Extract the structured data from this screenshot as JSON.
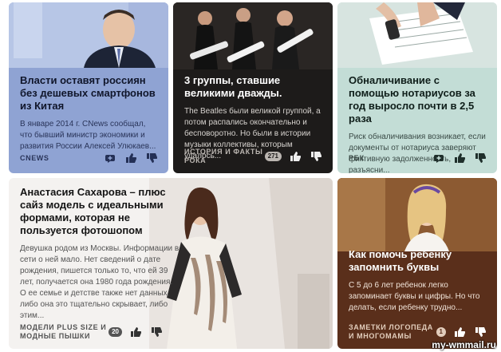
{
  "cards": [
    {
      "title": "Власти оставят россиян без дешевых смартфонов из Китая",
      "snippet": "В январе 2014 г. CNews сообщал, что бывший министр экономики и развития России Алексей Улюкаев...",
      "source": "CNEWS",
      "count": "",
      "colors": {
        "background": "#8fa3d3"
      }
    },
    {
      "title": "3 группы, ставшие великими дважды.",
      "snippet": "The Beatles были великой группой, а потом распались окончательно и бесповоротно. Но были в истории музыки коллективы, которым удалось...",
      "source_line1": "ИСТОРИЯ И ФАКТЫ",
      "source_line2": "РОКА",
      "count": "271",
      "colors": {
        "background": "#1d1b1a"
      }
    },
    {
      "title": "Обналичивание с помощью нотариусов за год выросло почти в 2,5 раза",
      "snippet": "Риск обналичивания возникает, если документы от нотариуса заверяют фиктивную задолженность, разъясни...",
      "source": "РБК",
      "count": "",
      "colors": {
        "background": "#c3ddd6"
      }
    },
    {
      "title": "Анастасия Сахарова – плюс сайз модель с идеальными формами, которая не пользуется фотошопом",
      "snippet": "Девушка родом из Москвы. Информации в сети о ней мало. Нет сведений о дате рождения, пишется только то, что ей 39 лет, получается она 1980 года рождения. О ее семье и детстве также нет данных, либо она это тщательно скрывает, либо этим...",
      "source_line1": "МОДЕЛИ PLUS SIZE И",
      "source_line2": "МОДНЫЕ ПЫШКИ",
      "count": "20",
      "colors": {
        "background": "#f4f2f0"
      }
    },
    {
      "title": "Как помочь ребенку запомнить буквы",
      "snippet": "С 5 до 6 лет ребенок легко запоминает буквы и цифры. Но что делать, если ребенку трудно...",
      "source_line1": "ЗАМЕТКИ ЛОГОПЕДА",
      "source_line2": "И МНОГОМАМЫ",
      "count": "1",
      "colors": {
        "background": "#5a2f1b"
      }
    }
  ],
  "watermark": "my-wmmail.ru",
  "icons": {
    "add": "plus-circle-icon",
    "like": "thumbs-up-icon",
    "dislike": "thumbs-down-icon"
  }
}
